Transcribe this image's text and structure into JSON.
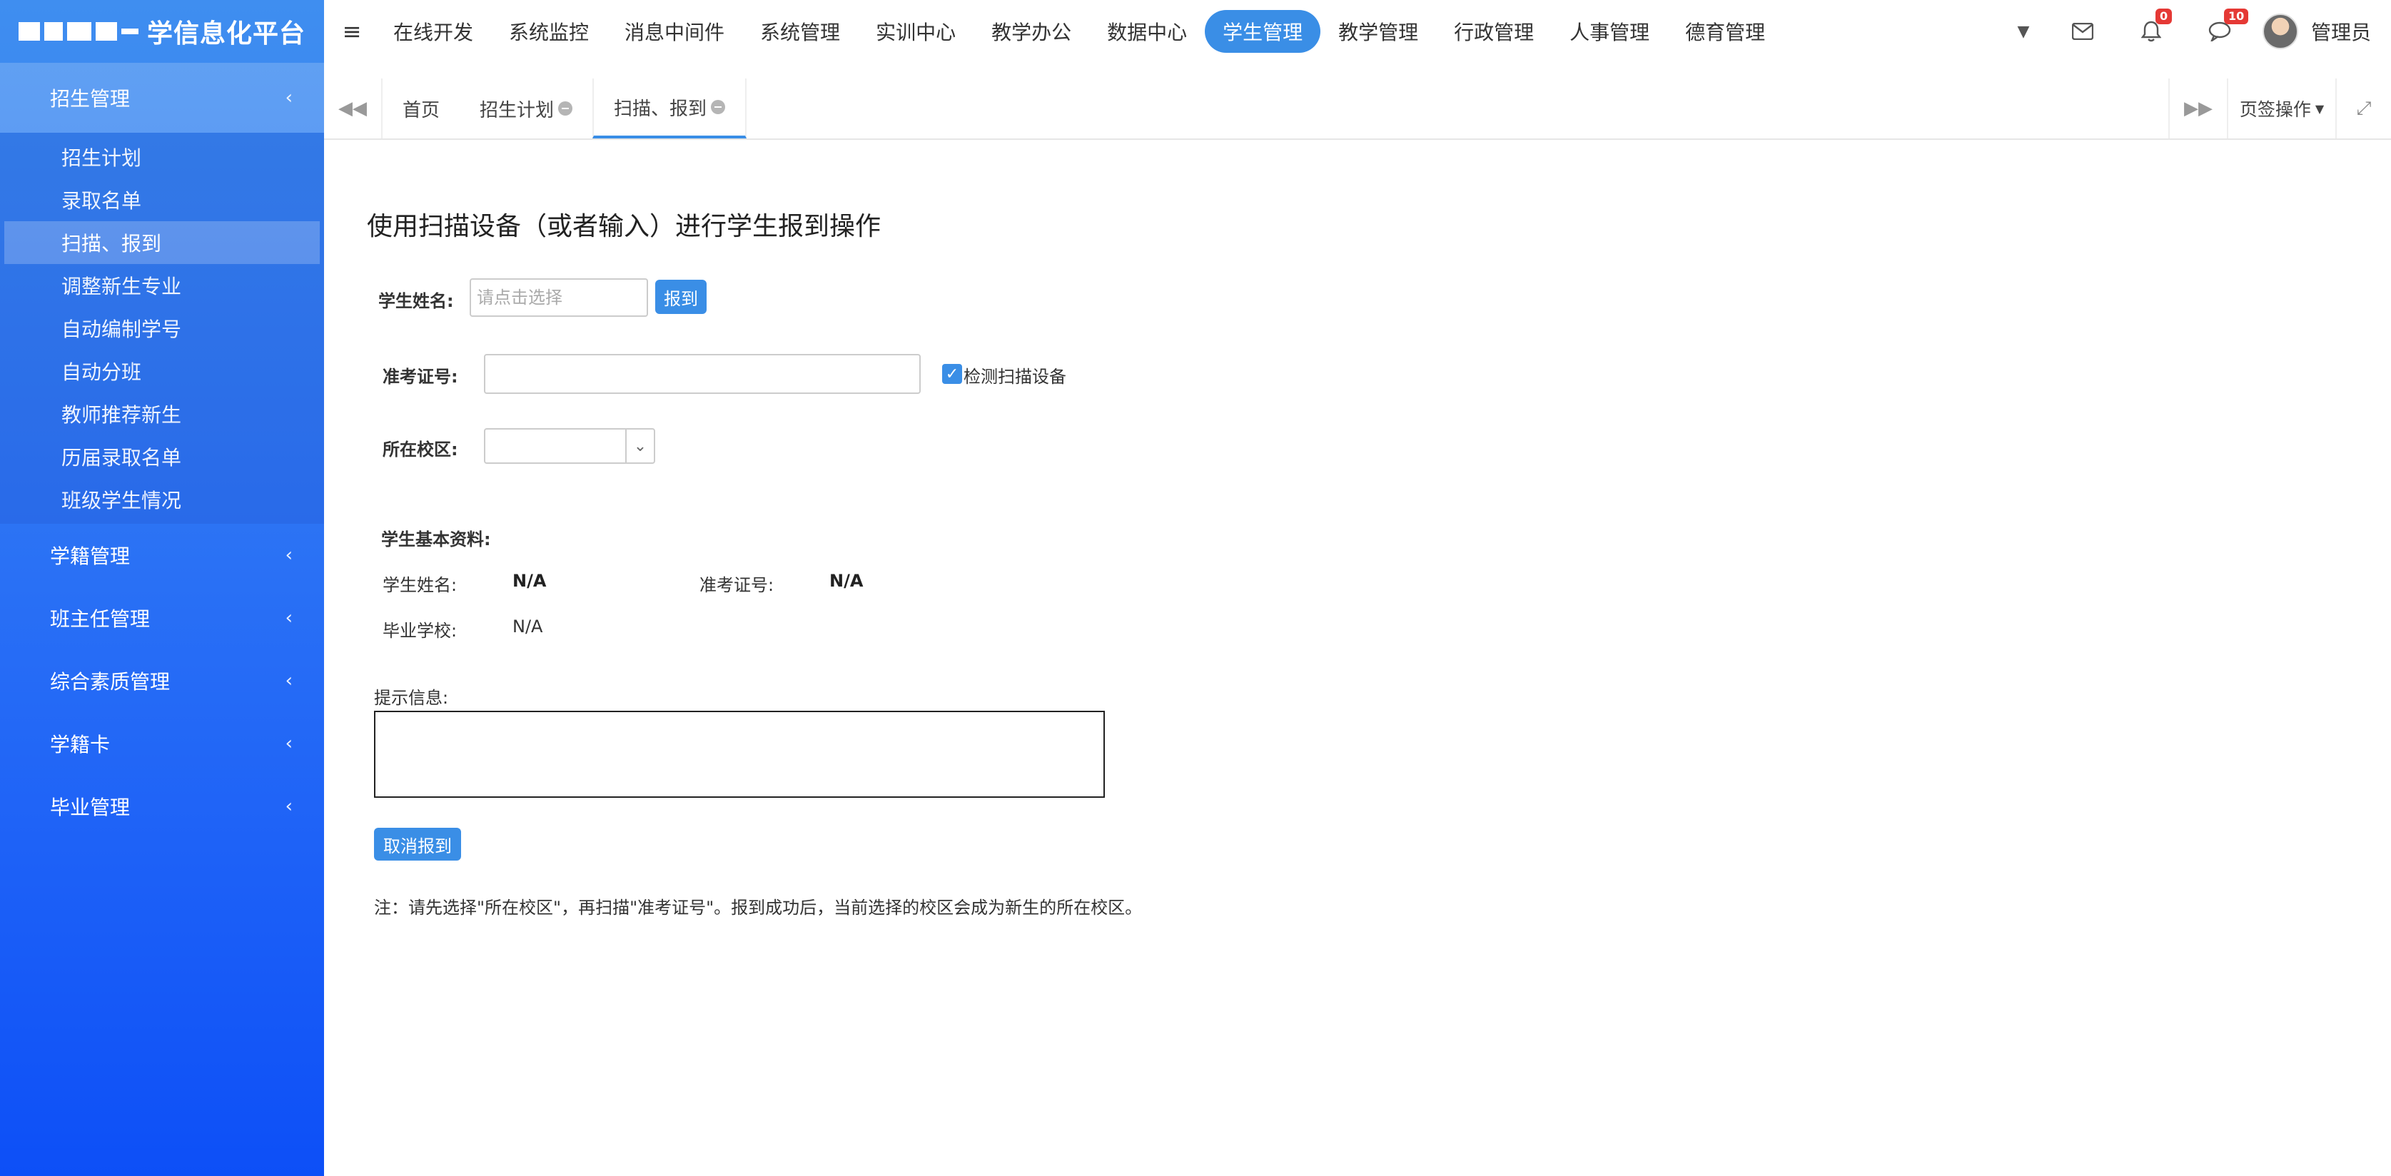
{
  "brand": {
    "title": "学信息化平台"
  },
  "sidebar": {
    "groups": [
      {
        "label": "招生管理",
        "open": true,
        "items": [
          {
            "label": "招生计划"
          },
          {
            "label": "录取名单"
          },
          {
            "label": "扫描、报到",
            "active": true
          },
          {
            "label": "调整新生专业"
          },
          {
            "label": "自动编制学号"
          },
          {
            "label": "自动分班"
          },
          {
            "label": "教师推荐新生"
          },
          {
            "label": "历届录取名单"
          },
          {
            "label": "班级学生情况"
          }
        ]
      },
      {
        "label": "学籍管理"
      },
      {
        "label": "班主任管理"
      },
      {
        "label": "综合素质管理"
      },
      {
        "label": "学籍卡"
      },
      {
        "label": "毕业管理"
      }
    ]
  },
  "topnav": {
    "items": [
      "在线开发",
      "系统监控",
      "消息中间件",
      "系统管理",
      "实训中心",
      "教学办公",
      "数据中心",
      "学生管理",
      "教学管理",
      "行政管理",
      "人事管理",
      "德育管理"
    ],
    "active": "学生管理",
    "bell_count": "0",
    "message_count": "10",
    "user_name": "管理员"
  },
  "tabs": {
    "items": [
      {
        "label": "首页",
        "closable": false
      },
      {
        "label": "招生计划",
        "closable": true
      },
      {
        "label": "扫描、报到",
        "closable": true,
        "active": true
      }
    ],
    "page_ops_label": "页签操作"
  },
  "content": {
    "heading": "使用扫描设备（或者输入）进行学生报到操作",
    "student_name_label": "学生姓名:",
    "student_name_placeholder": "请点击选择",
    "report_button": "报到",
    "ticket_label": "准考证号:",
    "ticket_value": "",
    "detect_scanner_label": "检测扫描设备",
    "detect_scanner_checked": true,
    "campus_label": "所在校区:",
    "campus_value": "",
    "basic_info_title": "学生基本资料:",
    "info_name_label": "学生姓名:",
    "info_name_value": "N/A",
    "info_ticket_label": "准考证号:",
    "info_ticket_value": "N/A",
    "info_school_label": "毕业学校:",
    "info_school_value": "N/A",
    "hint_label": "提示信息:",
    "hint_value": "",
    "cancel_button": "取消报到",
    "note": "注：请先选择\"所在校区\"，再扫描\"准考证号\"。报到成功后，当前选择的校区会成为新生的所在校区。"
  },
  "colors": {
    "accent": "#3a8ee6",
    "sidebar_top": "#3f8ef0",
    "sidebar_bottom": "#0d4ff7",
    "badge": "#e53935"
  }
}
